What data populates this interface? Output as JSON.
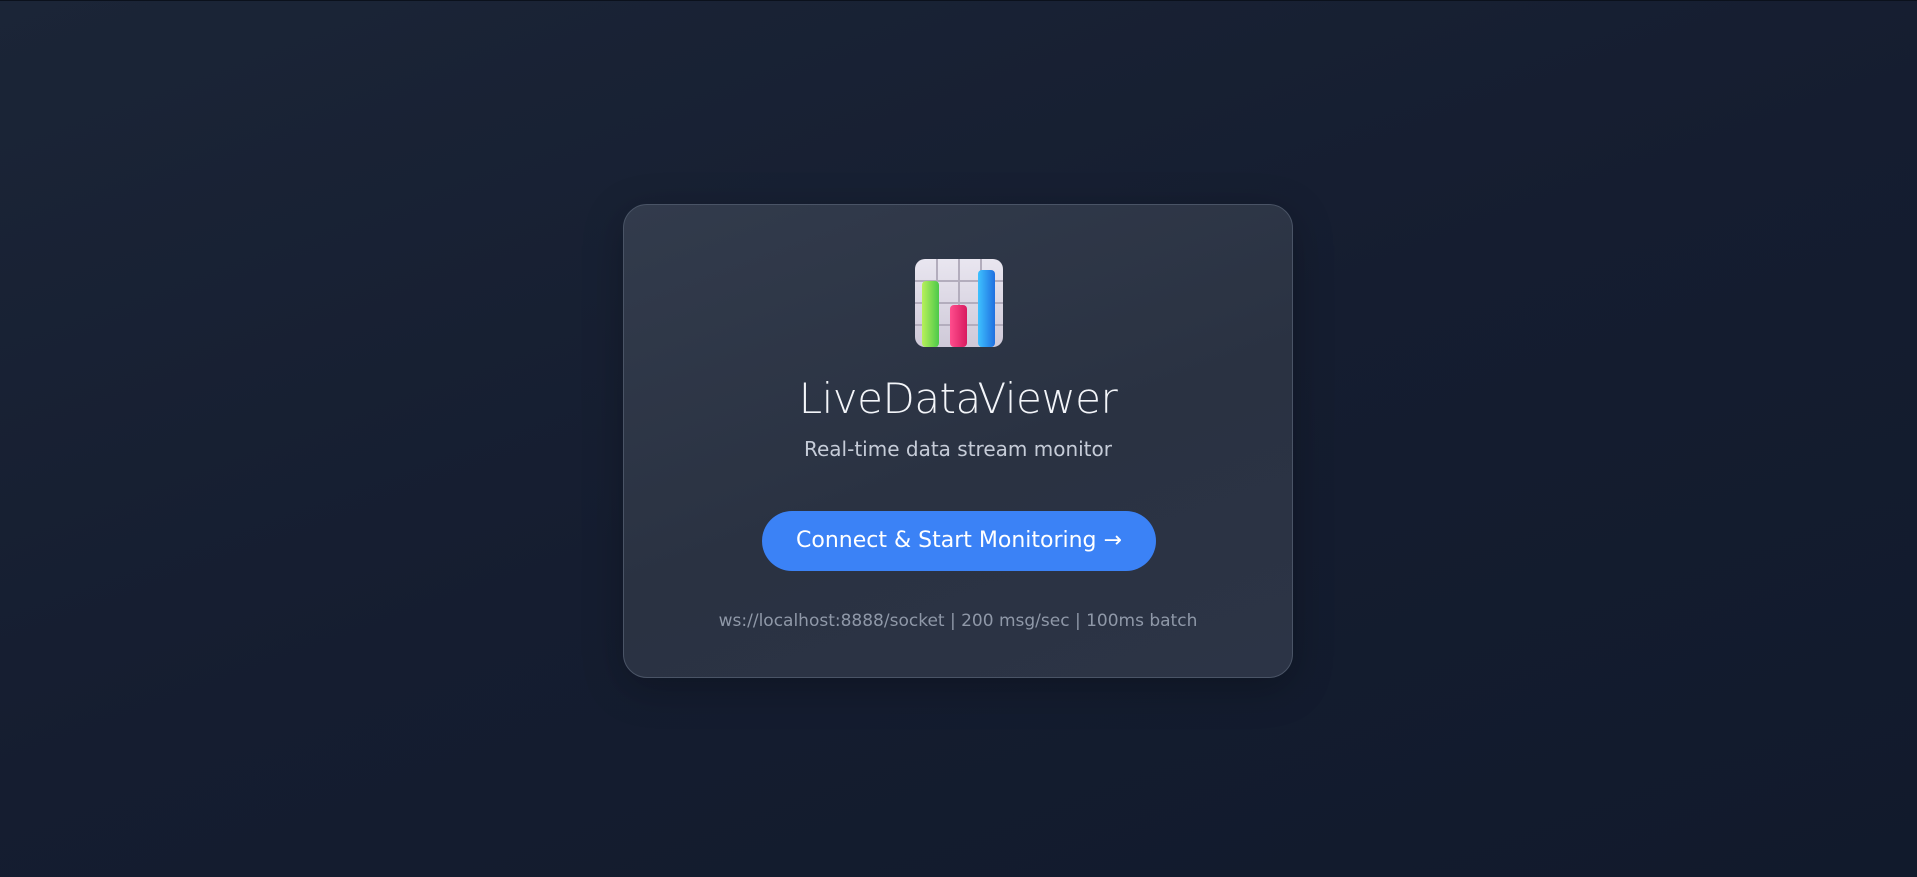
{
  "app": {
    "title": "LiveDataViewer",
    "subtitle": "Real-time data stream monitor",
    "logo_icon": "bar-chart-icon"
  },
  "actions": {
    "connect_label": "Connect & Start Monitoring →"
  },
  "connection": {
    "info": "ws://localhost:8888/socket | 200 msg/sec | 100ms batch"
  },
  "colors": {
    "accent": "#3b82f6",
    "card_bg": "#2e3647",
    "page_bg": "#151d30"
  }
}
